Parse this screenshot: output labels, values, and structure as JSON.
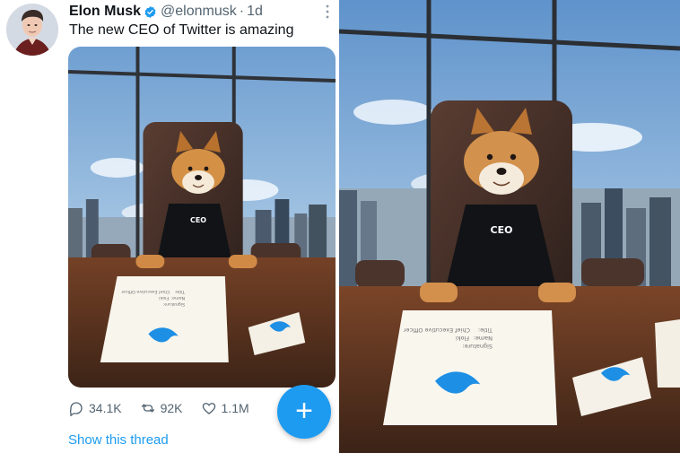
{
  "tweet": {
    "author_name": "Elon Musk",
    "handle": "@elonmusk",
    "separator": "·",
    "time": "1d",
    "text": "The new CEO of Twitter is amazing",
    "hoodie_text": "CEO",
    "paper_lines": [
      "Signature:",
      "Name:",
      "Title:",
      "Floki",
      "Chief Executive Officer"
    ],
    "stats": {
      "replies": "34.1K",
      "retweets": "92K",
      "likes": "1.1M"
    },
    "thread_link": "Show this thread"
  },
  "icons": {
    "verified": "verified-badge-icon",
    "more": "more-vertical-icon",
    "reply": "reply-icon",
    "retweet": "retweet-icon",
    "like": "heart-icon",
    "compose": "plus-icon"
  },
  "colors": {
    "accent": "#1d9bf0",
    "text": "#0f1419",
    "secondary": "#536471"
  }
}
